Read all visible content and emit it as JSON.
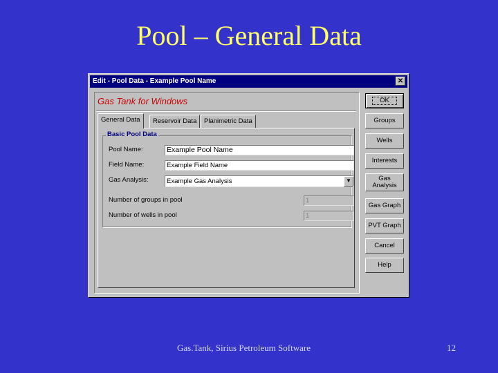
{
  "slide": {
    "title": "Pool – General Data",
    "footer": "Gas.Tank, Sirius Petroleum Software",
    "page_number": "12"
  },
  "window": {
    "title": "Edit - Pool Data - Example Pool Name",
    "close_glyph": "✕",
    "brand": "Gas Tank for Windows"
  },
  "tabs": [
    {
      "label": "General Data",
      "active": true
    },
    {
      "label": "Reservoir Data",
      "active": false
    },
    {
      "label": "Planimetric Data",
      "active": false
    }
  ],
  "group": {
    "label": "Basic Pool Data",
    "fields": [
      {
        "label": "Pool Name:",
        "value": "Example Pool Name"
      },
      {
        "label": "Field Name:",
        "value": "Example Field Name"
      },
      {
        "label": "Gas Analysis:",
        "value": "Example Gas Analysis"
      },
      {
        "label": "Number of groups in pool",
        "value": "1"
      },
      {
        "label": "Number of wells in pool",
        "value": "1"
      }
    ]
  },
  "buttons": {
    "ok": "OK",
    "groups": "Groups",
    "wells": "Wells",
    "interests": "Interests",
    "gas_analysis_1": "Gas",
    "gas_analysis_2": "Analysis",
    "gas_graph": "Gas Graph",
    "pvt_graph": "PVT Graph",
    "cancel": "Cancel",
    "help": "Help"
  },
  "icons": {
    "dropdown_arrow": "▼"
  },
  "colors": {
    "slide_background": "#3333cc",
    "title_text": "#ffff66",
    "titlebar": "#000080",
    "brand_text": "#cc0000"
  }
}
